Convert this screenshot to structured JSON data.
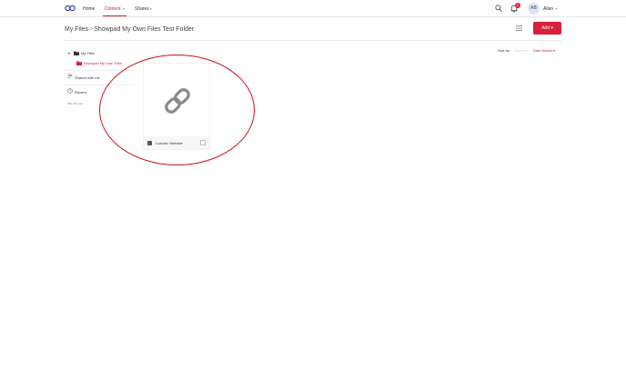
{
  "nav": {
    "home": "Home",
    "content": "Content",
    "shares": "Shares",
    "caret": "▾"
  },
  "notifications": {
    "badge": "1"
  },
  "user": {
    "initials": "AB",
    "name": "Allan",
    "caret": "▾"
  },
  "header": {
    "breadcrumb_root": "My Files",
    "breadcrumb_sep": ">",
    "breadcrumb_current": "Showpad My Own Files Test Folder",
    "add_label": "Add",
    "add_caret": "▾"
  },
  "sort": {
    "label": "Sort by:",
    "faded": "Name ▾",
    "value": "Date Added ▾"
  },
  "sidebar": {
    "tree_toggle": "▾",
    "root_label": "My Files",
    "child_label": "Showpad My Own Files",
    "shared_label": "Shared with me",
    "recent_label": "Recent",
    "storage": "966 KB used"
  },
  "card": {
    "title": "Lutronic Website"
  },
  "colors": {
    "accent": "#d6213a",
    "annotation": "#c8141e"
  }
}
